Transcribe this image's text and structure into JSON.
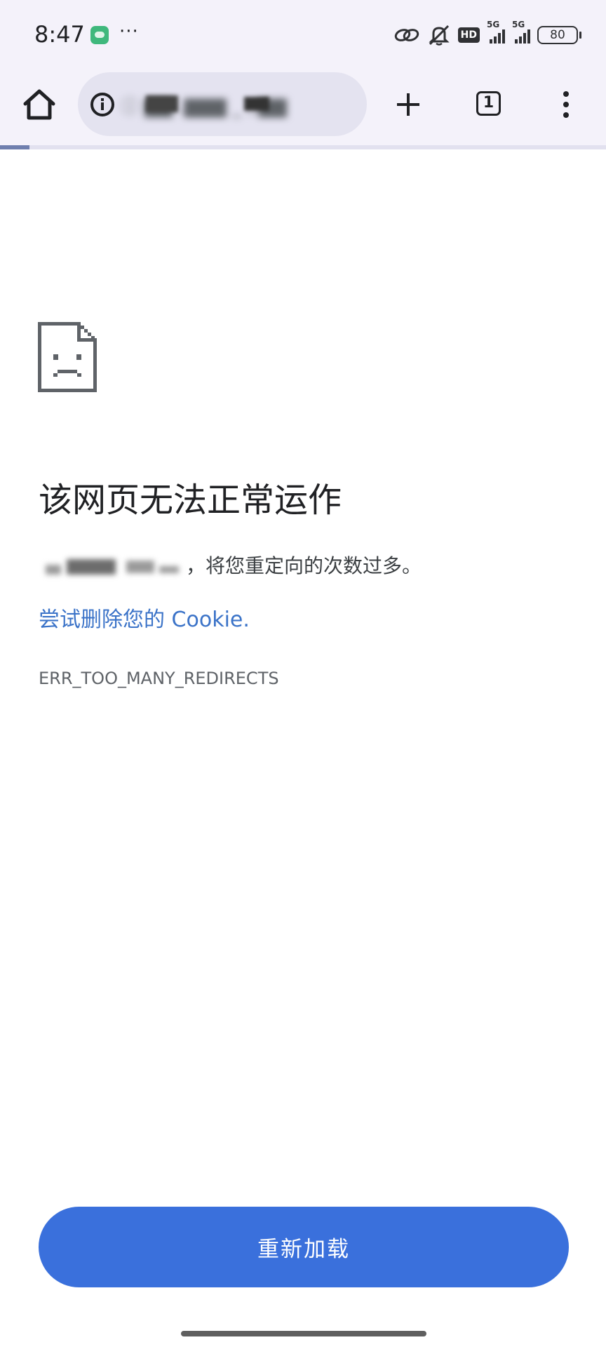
{
  "status_bar": {
    "time": "8:47",
    "more": "···",
    "hd_label": "HD",
    "network_1": "5G",
    "network_2": "5G",
    "battery": "80"
  },
  "toolbar": {
    "url_text": "ⓘ  ▇▇ .▇▇▇ _ ,,▇▇"
  },
  "error": {
    "title": "该网页无法正常运作",
    "detail_suffix": "，将您重定向的次数过多。",
    "cookie_link": "尝试删除您的 Cookie.",
    "code": "ERR_TOO_MANY_REDIRECTS"
  },
  "reload_button": {
    "label": "重新加载"
  },
  "colors": {
    "chrome_bg": "#f4f2fa",
    "omnibox_bg": "#e4e3f0",
    "accent": "#3a70dc",
    "link": "#3b73c8"
  }
}
